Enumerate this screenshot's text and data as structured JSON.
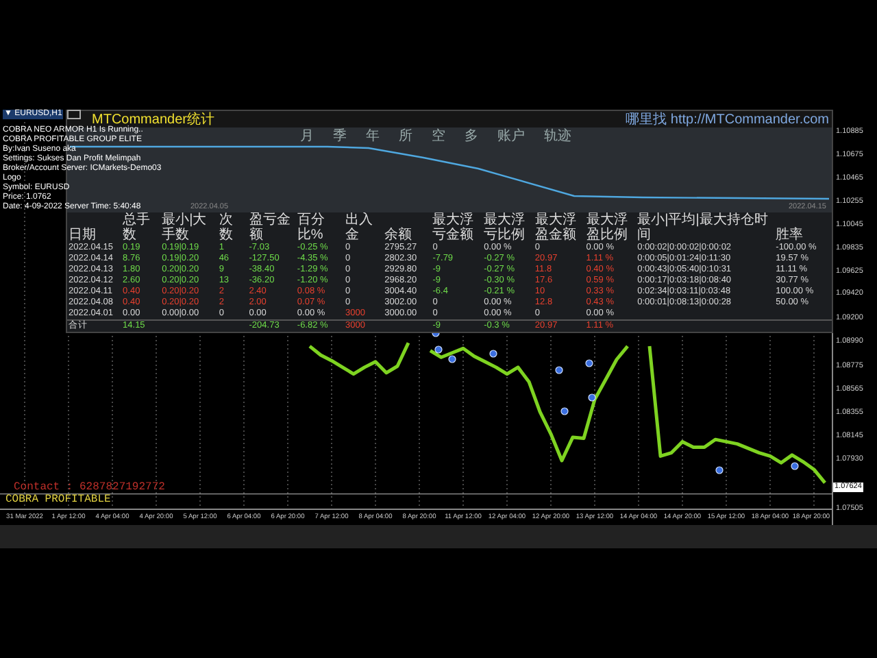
{
  "symbol_title": "▼ EURUSD,H1",
  "overlay_lines": [
    "COBRA NEO ARMOR H1 Is Running..",
    "COBRA PROFITABLE GROUP ELITE",
    "By:Ivan Suseno aka",
    "Settings: Sukses Dan Profit Melimpah",
    "Broker/Account Server: ICMarkets-Demo03",
    "Logo",
    "Symbol: EURUSD",
    "Price: 1.0762",
    "Date: 4-09-2022 Server Time: 5:40:48"
  ],
  "panel": {
    "title": "MTCommander统计",
    "link": "哪里找 http://MTCommander.com",
    "periods": [
      "月",
      "季",
      "年",
      "所",
      "空",
      "多",
      "账户",
      "轨迹"
    ],
    "equity_dates": [
      "2022.04.05",
      "2022.04.15"
    ],
    "table": {
      "columns": [
        "日期",
        "总手数",
        "最小|大手数",
        "次数",
        "盈亏金额",
        "百分比%",
        "出入金",
        "余额",
        "最大浮亏金额",
        "最大浮亏比例",
        "最大浮盈金额",
        "最大浮盈比例",
        "最小|平均|最大持仓时间",
        "胜率"
      ],
      "rows": [
        {
          "cells": [
            {
              "text": "2022.04.15",
              "color": "#d8d8d8"
            },
            {
              "text": "0.19",
              "color": "#6fdc4a"
            },
            {
              "text": "0.19|0.19",
              "color": "#6fdc4a"
            },
            {
              "text": "1",
              "color": "#6fdc4a"
            },
            {
              "text": "-7.03",
              "color": "#6fdc4a"
            },
            {
              "text": "-0.25 %",
              "color": "#6fdc4a"
            },
            {
              "text": "0",
              "color": "#d8d8d8"
            },
            {
              "text": "2795.27",
              "color": "#d8d8d8"
            },
            {
              "text": "0",
              "color": "#d8d8d8"
            },
            {
              "text": "0.00 %",
              "color": "#d8d8d8"
            },
            {
              "text": "0",
              "color": "#d8d8d8"
            },
            {
              "text": "0.00 %",
              "color": "#d8d8d8"
            },
            {
              "text": "0:00:02|0:00:02|0:00:02",
              "color": "#d8d8d8"
            },
            {
              "text": "-100.00 %",
              "color": "#d8d8d8"
            }
          ]
        },
        {
          "cells": [
            {
              "text": "2022.04.14",
              "color": "#d8d8d8"
            },
            {
              "text": "8.76",
              "color": "#6fdc4a"
            },
            {
              "text": "0.19|0.20",
              "color": "#6fdc4a"
            },
            {
              "text": "46",
              "color": "#6fdc4a"
            },
            {
              "text": "-127.50",
              "color": "#6fdc4a"
            },
            {
              "text": "-4.35 %",
              "color": "#6fdc4a"
            },
            {
              "text": "0",
              "color": "#d8d8d8"
            },
            {
              "text": "2802.30",
              "color": "#d8d8d8"
            },
            {
              "text": "-7.79",
              "color": "#6fdc4a"
            },
            {
              "text": "-0.27 %",
              "color": "#6fdc4a"
            },
            {
              "text": "20.97",
              "color": "#e8402e"
            },
            {
              "text": "1.11 %",
              "color": "#e8402e"
            },
            {
              "text": "0:00:05|0:01:24|0:11:30",
              "color": "#d8d8d8"
            },
            {
              "text": "19.57 %",
              "color": "#d8d8d8"
            }
          ]
        },
        {
          "cells": [
            {
              "text": "2022.04.13",
              "color": "#d8d8d8"
            },
            {
              "text": "1.80",
              "color": "#6fdc4a"
            },
            {
              "text": "0.20|0.20",
              "color": "#6fdc4a"
            },
            {
              "text": "9",
              "color": "#6fdc4a"
            },
            {
              "text": "-38.40",
              "color": "#6fdc4a"
            },
            {
              "text": "-1.29 %",
              "color": "#6fdc4a"
            },
            {
              "text": "0",
              "color": "#d8d8d8"
            },
            {
              "text": "2929.80",
              "color": "#d8d8d8"
            },
            {
              "text": "-9",
              "color": "#6fdc4a"
            },
            {
              "text": "-0.27 %",
              "color": "#6fdc4a"
            },
            {
              "text": "11.8",
              "color": "#e8402e"
            },
            {
              "text": "0.40 %",
              "color": "#e8402e"
            },
            {
              "text": "0:00:43|0:05:40|0:10:31",
              "color": "#d8d8d8"
            },
            {
              "text": "11.11 %",
              "color": "#d8d8d8"
            }
          ]
        },
        {
          "cells": [
            {
              "text": "2022.04.12",
              "color": "#d8d8d8"
            },
            {
              "text": "2.60",
              "color": "#6fdc4a"
            },
            {
              "text": "0.20|0.20",
              "color": "#6fdc4a"
            },
            {
              "text": "13",
              "color": "#6fdc4a"
            },
            {
              "text": "-36.20",
              "color": "#6fdc4a"
            },
            {
              "text": "-1.20 %",
              "color": "#6fdc4a"
            },
            {
              "text": "0",
              "color": "#d8d8d8"
            },
            {
              "text": "2968.20",
              "color": "#d8d8d8"
            },
            {
              "text": "-9",
              "color": "#6fdc4a"
            },
            {
              "text": "-0.30 %",
              "color": "#6fdc4a"
            },
            {
              "text": "17.6",
              "color": "#e8402e"
            },
            {
              "text": "0.59 %",
              "color": "#e8402e"
            },
            {
              "text": "0:00:17|0:03:18|0:08:40",
              "color": "#d8d8d8"
            },
            {
              "text": "30.77 %",
              "color": "#d8d8d8"
            }
          ]
        },
        {
          "cells": [
            {
              "text": "2022.04.11",
              "color": "#d8d8d8"
            },
            {
              "text": "0.40",
              "color": "#e8402e"
            },
            {
              "text": "0.20|0.20",
              "color": "#e8402e"
            },
            {
              "text": "2",
              "color": "#e8402e"
            },
            {
              "text": "2.40",
              "color": "#e8402e"
            },
            {
              "text": "0.08 %",
              "color": "#e8402e"
            },
            {
              "text": "0",
              "color": "#d8d8d8"
            },
            {
              "text": "3004.40",
              "color": "#d8d8d8"
            },
            {
              "text": "-6.4",
              "color": "#6fdc4a"
            },
            {
              "text": "-0.21 %",
              "color": "#6fdc4a"
            },
            {
              "text": "10",
              "color": "#e8402e"
            },
            {
              "text": "0.33 %",
              "color": "#e8402e"
            },
            {
              "text": "0:02:34|0:03:11|0:03:48",
              "color": "#d8d8d8"
            },
            {
              "text": "100.00 %",
              "color": "#d8d8d8"
            }
          ]
        },
        {
          "cells": [
            {
              "text": "2022.04.08",
              "color": "#d8d8d8"
            },
            {
              "text": "0.40",
              "color": "#e8402e"
            },
            {
              "text": "0.20|0.20",
              "color": "#e8402e"
            },
            {
              "text": "2",
              "color": "#e8402e"
            },
            {
              "text": "2.00",
              "color": "#e8402e"
            },
            {
              "text": "0.07 %",
              "color": "#e8402e"
            },
            {
              "text": "0",
              "color": "#d8d8d8"
            },
            {
              "text": "3002.00",
              "color": "#d8d8d8"
            },
            {
              "text": "0",
              "color": "#d8d8d8"
            },
            {
              "text": "0.00 %",
              "color": "#d8d8d8"
            },
            {
              "text": "12.8",
              "color": "#e8402e"
            },
            {
              "text": "0.43 %",
              "color": "#e8402e"
            },
            {
              "text": "0:00:01|0:08:13|0:00:28",
              "color": "#d8d8d8"
            },
            {
              "text": "50.00 %",
              "color": "#d8d8d8"
            }
          ]
        },
        {
          "cells": [
            {
              "text": "2022.04.01",
              "color": "#d8d8d8"
            },
            {
              "text": "0.00",
              "color": "#d8d8d8"
            },
            {
              "text": "0.00|0.00",
              "color": "#d8d8d8"
            },
            {
              "text": "0",
              "color": "#d8d8d8"
            },
            {
              "text": "0.00",
              "color": "#d8d8d8"
            },
            {
              "text": "0.00 %",
              "color": "#d8d8d8"
            },
            {
              "text": "3000",
              "color": "#e8402e"
            },
            {
              "text": "3000.00",
              "color": "#d8d8d8"
            },
            {
              "text": "0",
              "color": "#d8d8d8"
            },
            {
              "text": "0.00 %",
              "color": "#d8d8d8"
            },
            {
              "text": "0",
              "color": "#d8d8d8"
            },
            {
              "text": "0.00 %",
              "color": "#d8d8d8"
            },
            null,
            null
          ]
        }
      ],
      "total": {
        "cells": [
          {
            "text": "合计",
            "color": "#d8d8d8"
          },
          {
            "text": "14.15",
            "color": "#6fdc4a"
          },
          null,
          null,
          {
            "text": "-204.73",
            "color": "#6fdc4a"
          },
          {
            "text": "-6.82 %",
            "color": "#6fdc4a"
          },
          {
            "text": "3000",
            "color": "#e8402e"
          },
          null,
          {
            "text": "-9",
            "color": "#6fdc4a"
          },
          {
            "text": "-0.3 %",
            "color": "#6fdc4a"
          },
          {
            "text": "20.97",
            "color": "#e8402e"
          },
          {
            "text": "1.11 %",
            "color": "#e8402e"
          },
          null,
          null
        ]
      }
    }
  },
  "chart": {
    "current_price": "1.07624",
    "bottom_price": "1.07505",
    "chart_data": {
      "type": "line",
      "ylim": [
        1.075,
        1.1108
      ],
      "grid": true,
      "ref_lines": [
        {
          "axis": "y",
          "value": 1.0762
        }
      ],
      "categories": [
        "31 Mar 2022",
        null,
        null,
        null,
        "1 Apr 12:00",
        null,
        null,
        null,
        "4 Apr 04:00",
        null,
        null,
        null,
        "4 Apr 20:00",
        null,
        null,
        null,
        "5 Apr 12:00",
        null,
        null,
        null,
        "6 Apr 04:00",
        null,
        null,
        null,
        "6 Apr 20:00",
        null,
        null,
        null,
        "7 Apr 12:00",
        null,
        null,
        null,
        "8 Apr 04:00",
        null,
        null,
        null,
        "8 Apr 20:00",
        null,
        null,
        null,
        "11 Apr 12:00",
        null,
        null,
        null,
        "12 Apr 04:00",
        null,
        null,
        null,
        "12 Apr 20:00",
        null,
        null,
        null,
        "13 Apr 12:00",
        null,
        null,
        null,
        "14 Apr 04:00",
        null,
        null,
        null,
        "14 Apr 20:00",
        null,
        null,
        null,
        "15 Apr 12:00",
        null,
        null,
        null,
        "18 Apr 04:00",
        null,
        null,
        null,
        "18 Apr 20:00",
        null
      ],
      "series": [
        {
          "color": "#7ed321",
          "values": [
            null,
            null,
            null,
            null,
            null,
            null,
            null,
            null,
            null,
            null,
            null,
            null,
            null,
            null,
            null,
            null,
            null,
            null,
            null,
            null,
            null,
            null,
            null,
            null,
            null,
            null,
            1.0895,
            1.0887,
            1.0882,
            1.0876,
            1.087,
            1.0876,
            1.0881,
            1.0871,
            1.0877,
            1.0898,
            null,
            1.0891,
            1.0885,
            1.0889,
            1.0893,
            1.0886,
            1.0881,
            1.0876,
            1.087,
            1.0876,
            1.0863,
            1.0836,
            1.0816,
            1.0792,
            1.0813,
            1.0812,
            1.0847,
            1.0865,
            1.0883,
            1.0895,
            null,
            1.0895,
            1.0796,
            1.0799,
            1.0809,
            1.0804,
            1.0804,
            1.0811,
            1.0809,
            1.0807,
            1.0803,
            1.0799,
            1.0796,
            1.079,
            1.0797,
            1.0791,
            1.0784,
            1.0772
          ]
        }
      ],
      "yticks": [
        {
          "value": 1.10885,
          "label": "1.10885"
        },
        {
          "value": 1.10675,
          "label": "1.10675"
        },
        {
          "value": 1.10465,
          "label": "1.10465"
        },
        {
          "value": 1.10255,
          "label": "1.10255"
        },
        {
          "value": 1.10045,
          "label": "1.10045"
        },
        {
          "value": 1.09835,
          "label": "1.09835"
        },
        {
          "value": 1.09625,
          "label": "1.09625"
        },
        {
          "value": 1.0942,
          "label": "1.09420"
        },
        {
          "value": 1.092,
          "label": "1.09200"
        },
        {
          "value": 1.0899,
          "label": "1.08990"
        },
        {
          "value": 1.08775,
          "label": "1.08775"
        },
        {
          "value": 1.08565,
          "label": "1.08565"
        },
        {
          "value": 1.08355,
          "label": "1.08355"
        },
        {
          "value": 1.08145,
          "label": "1.08145"
        },
        {
          "value": 1.0793,
          "label": "1.07930"
        }
      ]
    },
    "contact": "Contact : 6287827192772",
    "brand": "COBRA PROFITABLE"
  }
}
